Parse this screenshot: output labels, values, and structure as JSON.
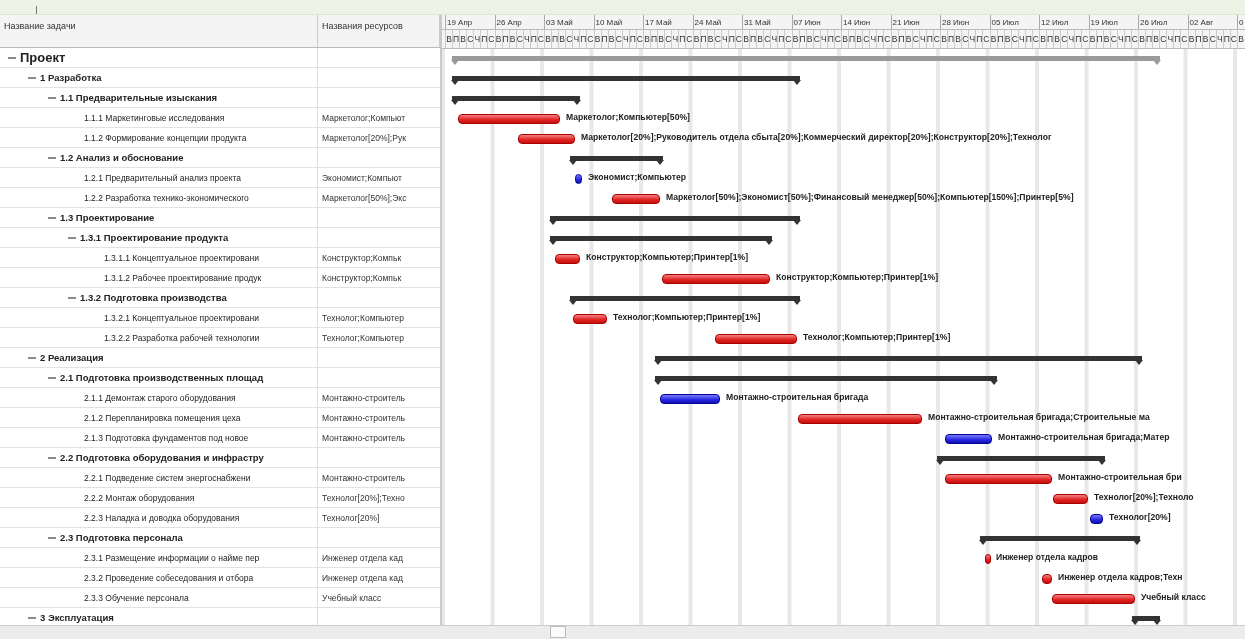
{
  "table": {
    "columns": [
      "Название задачи",
      "Названия ресурсов"
    ]
  },
  "timeline": {
    "weeks": [
      {
        "label": "19 Апр",
        "days": [
          "В",
          "П",
          "В",
          "С",
          "Ч",
          "П",
          "С"
        ]
      },
      {
        "label": "26 Апр",
        "days": [
          "В",
          "П",
          "В",
          "С",
          "Ч",
          "П",
          "С"
        ]
      },
      {
        "label": "03 Май",
        "days": [
          "В",
          "П",
          "В",
          "С",
          "Ч",
          "П",
          "С"
        ]
      },
      {
        "label": "10 Май",
        "days": [
          "В",
          "П",
          "В",
          "С",
          "Ч",
          "П",
          "С"
        ]
      },
      {
        "label": "17 Май",
        "days": [
          "В",
          "П",
          "В",
          "С",
          "Ч",
          "П",
          "С"
        ]
      },
      {
        "label": "24 Май",
        "days": [
          "В",
          "П",
          "В",
          "С",
          "Ч",
          "П",
          "С"
        ]
      },
      {
        "label": "31 Май",
        "days": [
          "В",
          "П",
          "В",
          "С",
          "Ч",
          "П",
          "С"
        ]
      },
      {
        "label": "07 Июн",
        "days": [
          "В",
          "П",
          "В",
          "С",
          "Ч",
          "П",
          "С"
        ]
      },
      {
        "label": "14 Июн",
        "days": [
          "В",
          "П",
          "В",
          "С",
          "Ч",
          "П",
          "С"
        ]
      },
      {
        "label": "21 Июн",
        "days": [
          "В",
          "П",
          "В",
          "С",
          "Ч",
          "П",
          "С"
        ]
      },
      {
        "label": "28 Июн",
        "days": [
          "В",
          "П",
          "В",
          "С",
          "Ч",
          "П",
          "С"
        ]
      },
      {
        "label": "05 Июл",
        "days": [
          "В",
          "П",
          "В",
          "С",
          "Ч",
          "П",
          "С"
        ]
      },
      {
        "label": "12 Июл",
        "days": [
          "В",
          "П",
          "В",
          "С",
          "Ч",
          "П",
          "С"
        ]
      },
      {
        "label": "19 Июл",
        "days": [
          "В",
          "П",
          "В",
          "С",
          "Ч",
          "П",
          "С"
        ]
      },
      {
        "label": "26 Июл",
        "days": [
          "В",
          "П",
          "В",
          "С",
          "Ч",
          "П",
          "С"
        ]
      },
      {
        "label": "02 Авг",
        "days": [
          "В",
          "П",
          "В",
          "С",
          "Ч",
          "П",
          "С"
        ]
      },
      {
        "label": "0",
        "days": [
          "В"
        ]
      }
    ]
  },
  "tasks": [
    {
      "kind": "project",
      "name": "Проект",
      "expanded": true,
      "children": [
        {
          "kind": "summary",
          "name": "1 Разработка",
          "expanded": true,
          "children": [
            {
              "kind": "summary",
              "name": "1.1 Предварительные изыскания",
              "expanded": true,
              "children": [
                {
                  "kind": "task",
                  "name": "1.1.1 Маркетинговые исследования",
                  "resources": "Маркетолог;Компьют",
                  "critical": true,
                  "bar_label": "Маркетолог;Компьютер[50%]"
                },
                {
                  "kind": "task",
                  "name": "1.1.2 Формирование концепции продукта",
                  "resources": "Маркетолог[20%];Рук",
                  "critical": true,
                  "bar_label": "Маркетолог[20%];Руководитель отдела сбыта[20%];Коммерческий директор[20%];Конструктор[20%];Технолог"
                }
              ]
            },
            {
              "kind": "summary",
              "name": "1.2 Анализ и обоснование",
              "expanded": true,
              "children": [
                {
                  "kind": "task",
                  "name": "1.2.1 Предварительный анализ проекта",
                  "resources": "Экономист;Компьют",
                  "critical": false,
                  "bar_label": "Экономист;Компьютер"
                },
                {
                  "kind": "task",
                  "name": "1.2.2 Разработка технико-экономического",
                  "resources": "Маркетолог[50%];Экс",
                  "critical": true,
                  "bar_label": "Маркетолог[50%];Экономист[50%];Финансовый менеджер[50%];Компьютер[150%];Принтер[5%]"
                }
              ]
            },
            {
              "kind": "summary",
              "name": "1.3 Проектирование",
              "expanded": true,
              "children": [
                {
                  "kind": "summary",
                  "name": "1.3.1 Проектирование продукта",
                  "expanded": true,
                  "children": [
                    {
                      "kind": "task",
                      "name": "1.3.1.1 Концептуальное проектировани",
                      "resources": "Конструктор;Компьк",
                      "critical": true,
                      "bar_label": "Конструктор;Компьютер;Принтер[1%]"
                    },
                    {
                      "kind": "task",
                      "name": "1.3.1.2 Рабочее проектирование продук",
                      "resources": "Конструктор;Компьк",
                      "critical": true,
                      "bar_label": "Конструктор;Компьютер;Принтер[1%]"
                    }
                  ]
                },
                {
                  "kind": "summary",
                  "name": "1.3.2 Подготовка производства",
                  "expanded": true,
                  "children": [
                    {
                      "kind": "task",
                      "name": "1.3.2.1 Концептуальное проектировани",
                      "resources": "Технолог;Компьютер",
                      "critical": true,
                      "bar_label": "Технолог;Компьютер;Принтер[1%]"
                    },
                    {
                      "kind": "task",
                      "name": "1.3.2.2 Разработка рабочей технологии",
                      "resources": "Технолог;Компьютер",
                      "critical": true,
                      "bar_label": "Технолог;Компьютер;Принтер[1%]"
                    }
                  ]
                }
              ]
            }
          ]
        },
        {
          "kind": "summary",
          "name": "2 Реализация",
          "expanded": true,
          "children": [
            {
              "kind": "summary",
              "name": "2.1 Подготовка производственных площад",
              "expanded": true,
              "children": [
                {
                  "kind": "task",
                  "name": "2.1.1 Демонтаж старого оборудования",
                  "resources": "Монтажно-строитель",
                  "critical": false,
                  "bar_label": "Монтажно-строительная бригада"
                },
                {
                  "kind": "task",
                  "name": "2.1.2 Перепланировка помещения цеха",
                  "resources": "Монтажно-строитель",
                  "critical": true,
                  "bar_label": "Монтажно-строительная бригада;Строительные ма"
                },
                {
                  "kind": "task",
                  "name": "2.1.3 Подготовка фундаментов под новое",
                  "resources": "Монтажно-строитель",
                  "critical": false,
                  "bar_label": "Монтажно-строительная бригада;Матер"
                }
              ]
            },
            {
              "kind": "summary",
              "name": "2.2 Подготовка оборудования и инфрастру",
              "expanded": true,
              "children": [
                {
                  "kind": "task",
                  "name": "2.2.1 Подведение систем энергоснабжени",
                  "resources": "Монтажно-строитель",
                  "critical": true,
                  "bar_label": "Монтажно-строительная бри"
                },
                {
                  "kind": "task",
                  "name": "2.2.2 Монтаж оборудования",
                  "resources": "Технолог[20%];Техно",
                  "critical": true,
                  "bar_label": "Технолог[20%];Техноло"
                },
                {
                  "kind": "task",
                  "name": "2.2.3 Наладка и доводка оборудования",
                  "resources": "Технолог[20%]",
                  "critical": false,
                  "bar_label": "Технолог[20%]"
                }
              ]
            },
            {
              "kind": "summary",
              "name": "2.3 Подготовка персонала",
              "expanded": true,
              "children": [
                {
                  "kind": "task",
                  "name": "2.3.1 Размещение информации о найме пер",
                  "resources": "Инженер отдела кад",
                  "critical": true,
                  "bar_label": "Инженер отдела кадров"
                },
                {
                  "kind": "task",
                  "name": "2.3.2 Проведение собеседования и отбора",
                  "resources": "Инженер отдела кад",
                  "critical": true,
                  "bar_label": "Инженер отдела кадров;Техн"
                },
                {
                  "kind": "task",
                  "name": "2.3.3 Обучение персонала",
                  "resources": "Учебный класс",
                  "critical": true,
                  "bar_label": "Учебный класс"
                }
              ]
            }
          ]
        },
        {
          "kind": "summary",
          "name": "3 Эксплуатация",
          "expanded": true
        }
      ]
    }
  ]
}
